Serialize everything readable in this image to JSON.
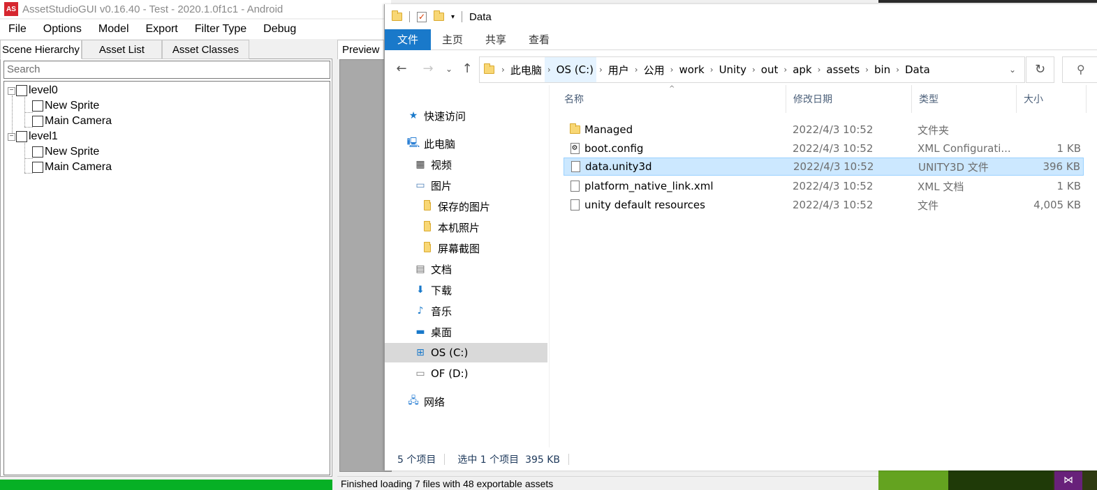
{
  "assetstudio": {
    "title": "AssetStudioGUI v0.16.40 - Test - 2020.1.0f1c1 - Android",
    "logo_text": "AS",
    "menu": [
      "File",
      "Options",
      "Model",
      "Export",
      "Filter Type",
      "Debug"
    ],
    "tabs": [
      "Scene Hierarchy",
      "Asset List",
      "Asset Classes"
    ],
    "search_placeholder": "Search",
    "tree": [
      {
        "label": "level0",
        "children": [
          "New Sprite",
          "Main Camera"
        ]
      },
      {
        "label": "level1",
        "children": [
          "New Sprite",
          "Main Camera"
        ]
      }
    ],
    "preview_tab": "Preview",
    "status": "Finished loading 7 files with 48 exportable assets",
    "progress": 1.0
  },
  "explorer": {
    "title": "Data",
    "ribbon_tabs": [
      "文件",
      "主页",
      "共享",
      "查看"
    ],
    "breadcrumbs": [
      "此电脑",
      "OS (C:)",
      "用户",
      "公用",
      "work",
      "Unity",
      "out",
      "apk",
      "assets",
      "bin",
      "Data"
    ],
    "sidebar": {
      "quick_access": "快速访问",
      "this_pc": "此电脑",
      "videos": "视频",
      "pictures": "图片",
      "saved_pictures": "保存的图片",
      "camera_roll": "本机照片",
      "screenshots": "屏幕截图",
      "documents": "文档",
      "downloads": "下载",
      "music": "音乐",
      "desktop": "桌面",
      "drive_c": "OS (C:)",
      "drive_d": "OF (D:)",
      "network": "网络"
    },
    "columns": {
      "name": "名称",
      "date": "修改日期",
      "type": "类型",
      "size": "大小"
    },
    "files": [
      {
        "name": "Managed",
        "date": "2022/4/3 10:52",
        "type": "文件夹",
        "size": ""
      },
      {
        "name": "boot.config",
        "date": "2022/4/3 10:52",
        "type": "XML Configurati...",
        "size": "1 KB"
      },
      {
        "name": "data.unity3d",
        "date": "2022/4/3 10:52",
        "type": "UNITY3D 文件",
        "size": "396 KB"
      },
      {
        "name": "platform_native_link.xml",
        "date": "2022/4/3 10:52",
        "type": "XML 文档",
        "size": "1 KB"
      },
      {
        "name": "unity default resources",
        "date": "2022/4/3 10:52",
        "type": "文件",
        "size": "4,005 KB"
      }
    ],
    "status": {
      "count": "5 个项目",
      "selection": "选中 1 个项目  395 KB"
    }
  },
  "colors": {
    "ribbon_file": "#1979ca",
    "selection": "#cce8ff",
    "progress": "#06b025"
  }
}
